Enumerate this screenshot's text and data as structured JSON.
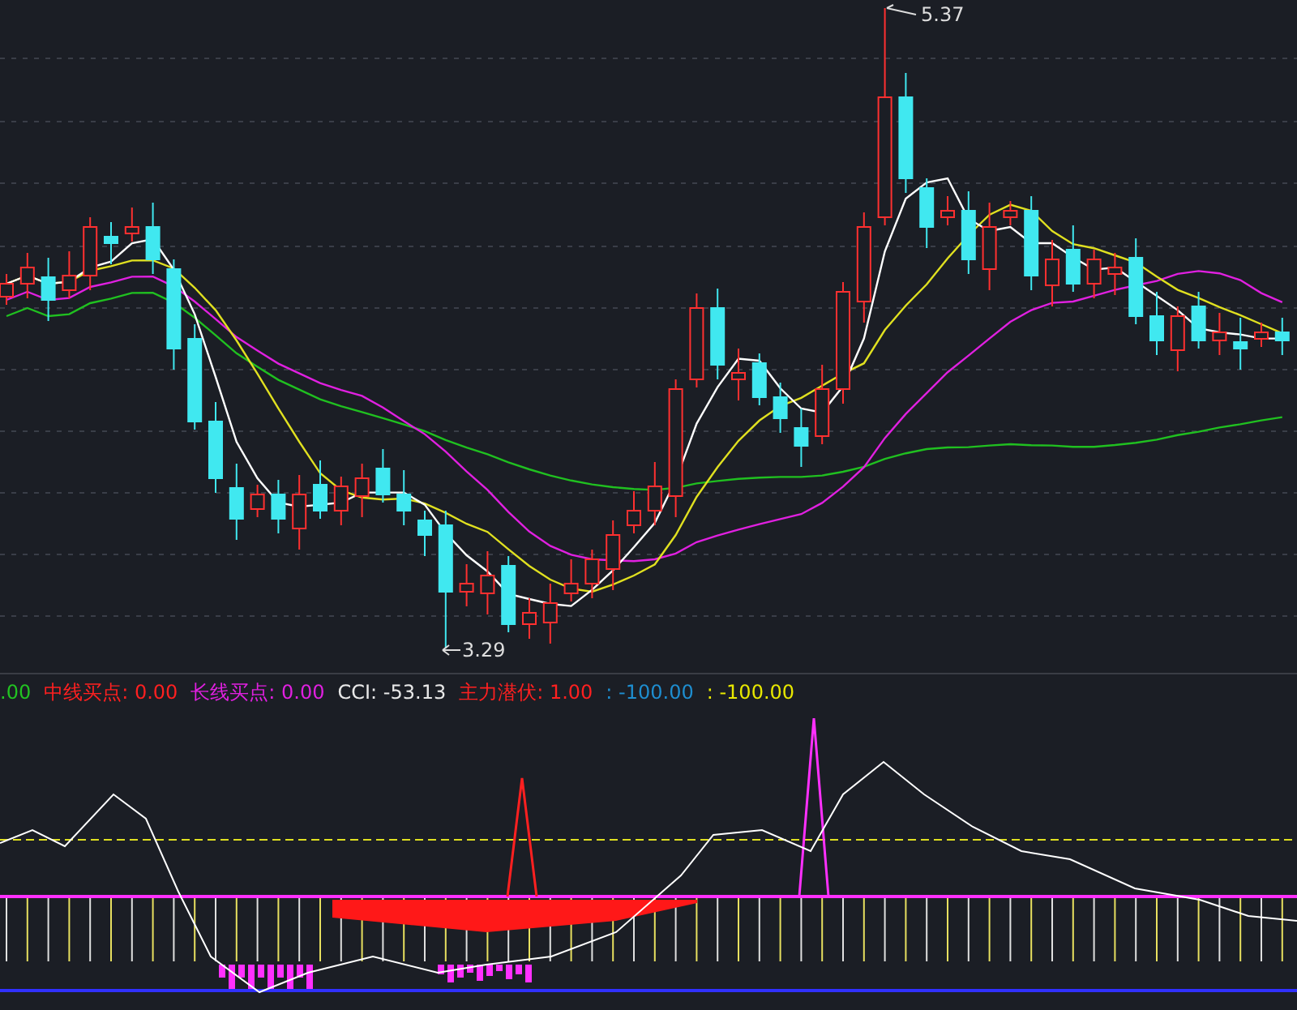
{
  "price_chart": {
    "high_label": "5.37",
    "low_label": "3.29"
  },
  "indicator_legend": [
    {
      "text": ".00",
      "color": "#22c322"
    },
    {
      "text": "中线买点: 0.00",
      "color": "#ff2020"
    },
    {
      "text": "长线买点: 0.00",
      "color": "#e020e0"
    },
    {
      "text": "CCI: -53.13",
      "color": "#e8e8e8"
    },
    {
      "text": "主力潜伏: 1.00",
      "color": "#ff2020"
    },
    {
      "text": ": -100.00",
      "color": "#1e8ed0"
    },
    {
      "text": ": -100.00",
      "color": "#e8e800"
    }
  ]
}
